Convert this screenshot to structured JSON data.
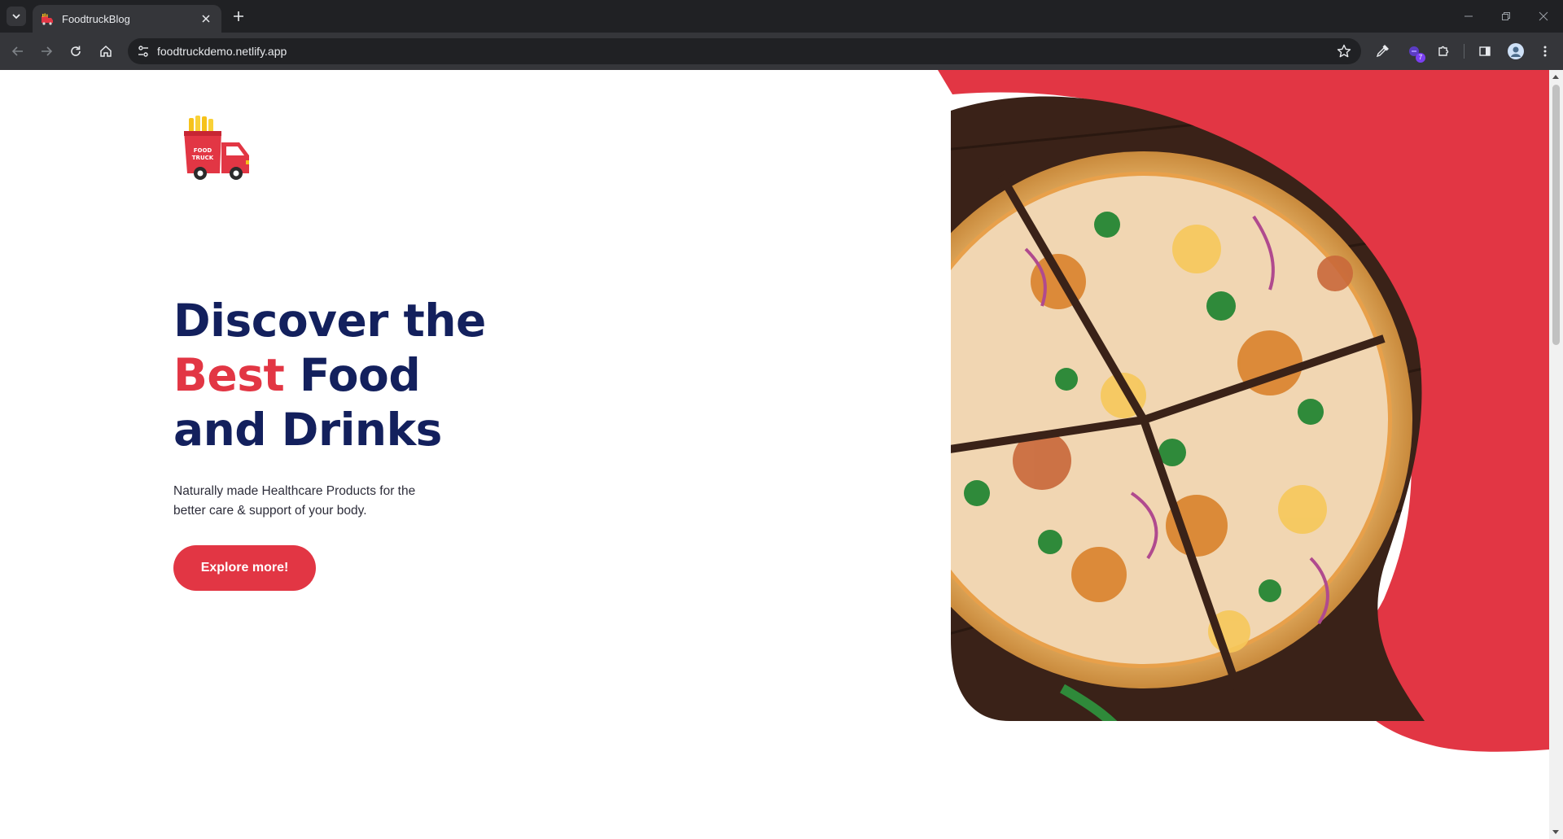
{
  "browser": {
    "tab_title": "FoodtruckBlog",
    "url": "foodtruckdemo.netlify.app",
    "extension_badge": "7"
  },
  "brand": {
    "logo_text_line1": "FOOD",
    "logo_text_line2": "TRUCK",
    "primary_color": "#e23644",
    "navy_color": "#13205d"
  },
  "hero": {
    "title_line1": "Discover the",
    "title_accent": "Best",
    "title_line2_rest": " Food",
    "title_line3": "and Drinks",
    "subtitle": "Naturally made Healthcare Products for the better care & support of your body.",
    "cta_label": "Explore more!"
  },
  "icons": {
    "tab_favicon": "food-truck-icon",
    "back": "arrow-left-icon",
    "forward": "arrow-right-icon",
    "reload": "reload-icon",
    "home": "home-icon",
    "site_info": "tune-icon",
    "bookmark": "star-icon",
    "eyedropper": "eyedropper-icon",
    "extension": "extension-icon",
    "puzzle": "puzzle-icon",
    "side_panel": "side-panel-icon",
    "profile": "avatar-icon",
    "menu": "kebab-menu-icon"
  }
}
